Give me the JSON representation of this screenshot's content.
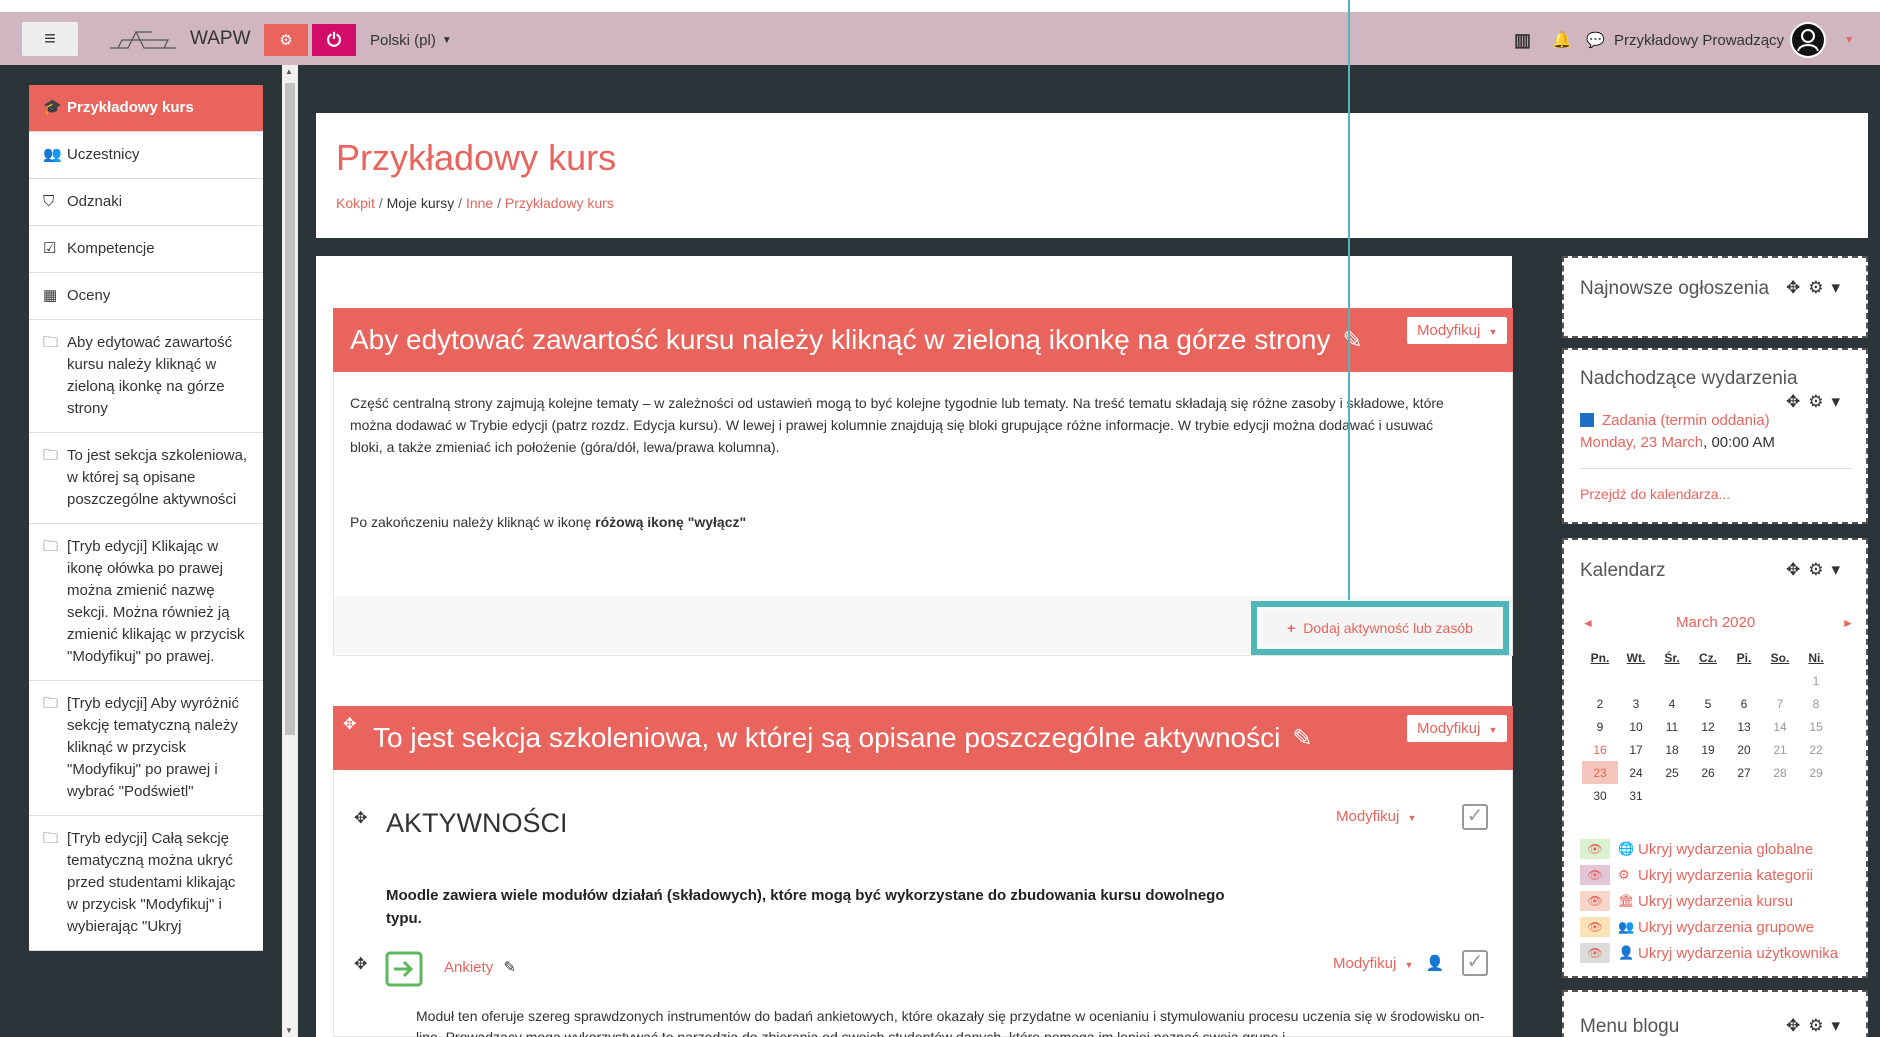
{
  "navbar": {
    "brand": "WAPW",
    "language": "Polski (pl)",
    "user_name": "Przykładowy Prowadzący"
  },
  "drawer": {
    "items": [
      {
        "label": "Przykładowy kurs",
        "icon": "graduation-cap-icon",
        "glyph": "🎓"
      },
      {
        "label": "Uczestnicy",
        "icon": "users-icon",
        "glyph": "👥"
      },
      {
        "label": "Odznaki",
        "icon": "shield-icon",
        "glyph": "⛉"
      },
      {
        "label": "Kompetencje",
        "icon": "checkbox-icon",
        "glyph": "☑"
      },
      {
        "label": "Oceny",
        "icon": "table-icon",
        "glyph": "▦"
      },
      {
        "label": "Aby edytować zawartość kursu należy kliknąć w zieloną ikonkę na górze strony",
        "icon": "folder-icon",
        "glyph": "🗀"
      },
      {
        "label": "To jest sekcja szkoleniowa, w której są opisane poszczególne aktywności",
        "icon": "folder-icon",
        "glyph": "🗀"
      },
      {
        "label": "[Tryb edycji] Klikając w ikonę ołówka po prawej można zmienić nazwę sekcji. Można również ją zmienić klikając w przycisk \"Modyfikuj\" po prawej.",
        "icon": "folder-icon",
        "glyph": "🗀"
      },
      {
        "label": "[Tryb edycji] Aby wyróżnić sekcję tematyczną należy kliknąć w przycisk \"Modyfikuj\" po prawej i wybrać \"Podświetl\"",
        "icon": "folder-icon",
        "glyph": "🗀"
      },
      {
        "label": "[Tryb edycji] Całą sekcję tematyczną można ukryć przed studentami klikając w przycisk \"Modyfikuj\" i wybierając \"Ukryj",
        "icon": "folder-icon",
        "glyph": "🗀"
      }
    ]
  },
  "header": {
    "title": "Przykładowy kurs",
    "breadcrumb": [
      "Kokpit",
      "Moje kursy",
      "Inne",
      "Przykładowy kurs"
    ]
  },
  "section1": {
    "title": "Aby edytować zawartość kursu należy kliknąć w zieloną ikonkę na górze strony",
    "modify": "Modyfikuj",
    "body": "Część centralną strony zajmują kolejne tematy – w zależności od ustawień mogą to być kolejne tygodnie lub tematy. Na treść tematu składają się różne zasoby i składowe, które można dodawać w Trybie edycji (patrz rozdz. Edycja kursu). W lewej i prawej kolumnie znajdują się bloki grupujące różne informacje. W trybie edycji można dodawać i usuwać bloki, a także zmieniać ich położenie (góra/dół, lewa/prawa kolumna).",
    "note_prefix": "Po zakończeniu należy kliknąć w ikonę ",
    "note_bold": "różową ikonę \"wyłącz\"",
    "add_activity": "Dodaj aktywność lub zasób"
  },
  "section2": {
    "title": "To jest sekcja szkoleniowa, w której są opisane poszczególne aktywności",
    "modify": "Modyfikuj",
    "activities_heading": "AKTYWNOŚCI",
    "activities_modify": "Modyfikuj",
    "activities_desc": "Moodle zawiera wiele modułów działań (składowych), które mogą być wykorzystane do zbudowania kursu dowolnego typu.",
    "ankiety_label": "Ankiety",
    "ankiety_modify": "Modyfikuj",
    "ankiety_desc": "Moduł ten oferuje szereg sprawdzonych instrumentów do badań ankietowych, które okazały się przydatne w ocenianiu i stymulowaniu procesu uczenia się w środowisku on-line. Prowadzący mogą wykorzystywać te narzędzia do zbierania od swoich studentów danych, które pomogą im lepiej poznać swoją grupę i"
  },
  "blocks": {
    "announcements": "Najnowsze ogłoszenia",
    "upcoming": {
      "title": "Nadchodzące wydarzenia",
      "event_name": "Zadania (termin oddania)",
      "event_date": "Monday, 23 March",
      "event_time": ", 00:00 AM",
      "goto_calendar": "Przejdź do kalendarza..."
    },
    "calendar": {
      "title": "Kalendarz",
      "month": "March 2020",
      "weekdays": [
        "Pn.",
        "Wt.",
        "Śr.",
        "Cz.",
        "Pi.",
        "So.",
        "Ni."
      ],
      "weeks": [
        [
          "",
          "",
          "",
          "",
          "",
          "",
          "1"
        ],
        [
          "2",
          "3",
          "4",
          "5",
          "6",
          "7",
          "8"
        ],
        [
          "9",
          "10",
          "11",
          "12",
          "13",
          "14",
          "15"
        ],
        [
          "16",
          "17",
          "18",
          "19",
          "20",
          "21",
          "22"
        ],
        [
          "23",
          "24",
          "25",
          "26",
          "27",
          "28",
          "29"
        ],
        [
          "30",
          "31",
          "",
          "",
          "",
          "",
          ""
        ]
      ],
      "filters": [
        {
          "label": "Ukryj wydarzenia globalne",
          "color": "#d9f2d0",
          "glyph": "🌐"
        },
        {
          "label": "Ukryj wydarzenia kategorii",
          "color": "#e3c6d6",
          "glyph": "⚙"
        },
        {
          "label": "Ukryj wydarzenia kursu",
          "color": "#f7d5c9",
          "glyph": "🏛"
        },
        {
          "label": "Ukryj wydarzenia grupowe",
          "color": "#fbe3b5",
          "glyph": "👥"
        },
        {
          "label": "Ukryj wydarzenia użytkownika",
          "color": "#dcdcdc",
          "glyph": "👤"
        }
      ]
    },
    "blog": "Menu blogu"
  },
  "colors": {
    "accent": "#e9645c",
    "navbar": "#cfb6c0",
    "teal": "#4fb7b7",
    "dark": "#2a3439"
  }
}
